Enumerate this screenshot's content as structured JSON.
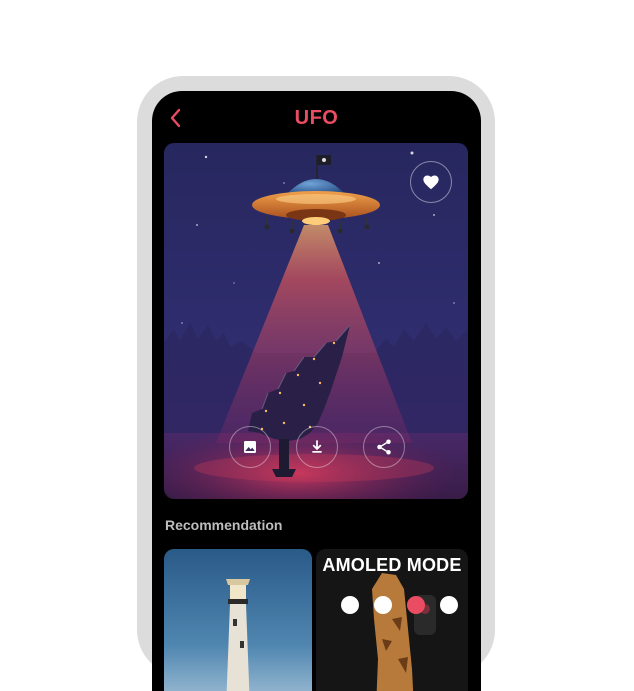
{
  "header": {
    "title": "UFO"
  },
  "hero": {
    "favorite_icon": "heart-icon",
    "actions": [
      {
        "name": "set-wallpaper-button",
        "icon": "image-icon"
      },
      {
        "name": "download-button",
        "icon": "download-icon"
      },
      {
        "name": "share-button",
        "icon": "share-icon"
      }
    ]
  },
  "recommendation": {
    "title": "Recommendation",
    "items": [
      {
        "name": "lighthouse-wallpaper"
      },
      {
        "name": "amoled-mode-wallpaper",
        "label": "AMOLED MODE"
      }
    ]
  },
  "colors": {
    "accent": "#ea4d63",
    "screen_bg": "#000000",
    "frame": "#dcdcdc"
  }
}
